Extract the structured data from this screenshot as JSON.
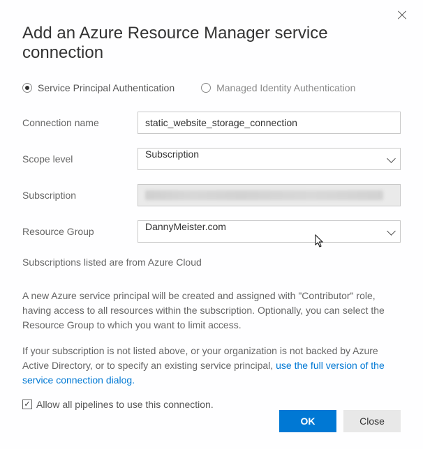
{
  "title": "Add an Azure Resource Manager service connection",
  "auth": {
    "servicePrincipal": "Service Principal Authentication",
    "managedIdentity": "Managed Identity Authentication"
  },
  "form": {
    "connectionNameLabel": "Connection name",
    "connectionNameValue": "static_website_storage_connection",
    "scopeLevelLabel": "Scope level",
    "scopeLevelValue": "Subscription",
    "subscriptionLabel": "Subscription",
    "resourceGroupLabel": "Resource Group",
    "resourceGroupValue": "DannyMeister.com"
  },
  "note": "Subscriptions listed are from Azure Cloud",
  "description1": "A new Azure service principal will be created and assigned with \"Contributor\" role, having access to all resources within the subscription. Optionally, you can select the Resource Group to which you want to limit access.",
  "description2a": "If your subscription is not listed above, or your organization is not backed by Azure Active Directory, or to specify an existing service principal, ",
  "linkText": "use the full version of the service connection dialog.",
  "checkboxLabel": "Allow all pipelines to use this connection.",
  "buttons": {
    "ok": "OK",
    "close": "Close"
  }
}
